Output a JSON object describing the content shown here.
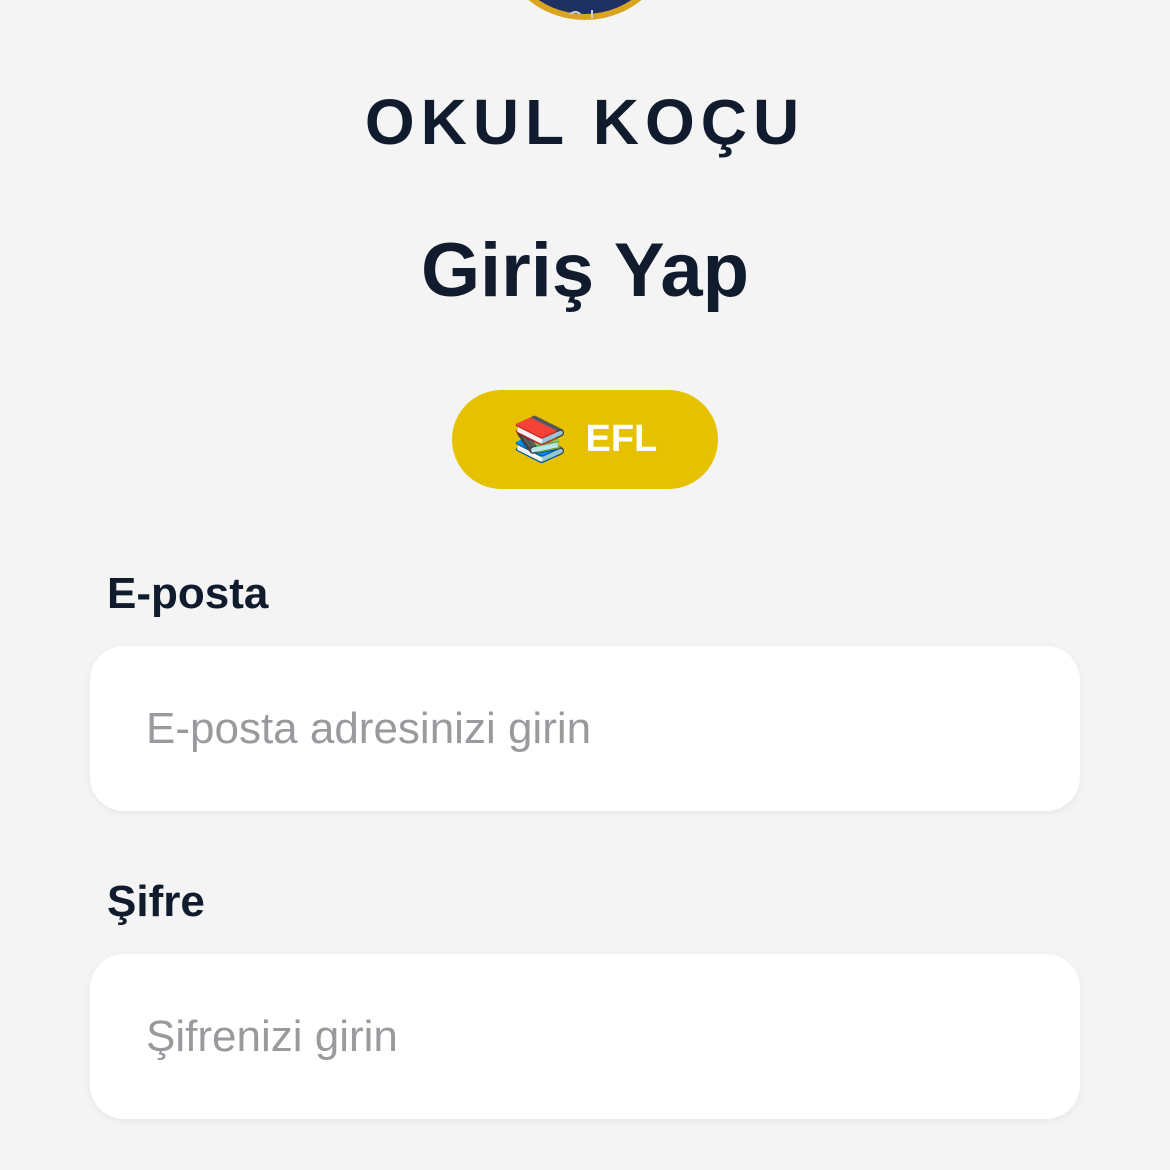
{
  "app": {
    "name": "OKUL KOÇU"
  },
  "page": {
    "title": "Giriş Yap"
  },
  "badge": {
    "icon": "📚",
    "icon_name": "books-icon",
    "label": "EFL",
    "color": "#e5c100"
  },
  "form": {
    "email": {
      "label": "E-posta",
      "value": "",
      "placeholder": "E-posta adresinizi girin"
    },
    "password": {
      "label": "Şifre",
      "value": "",
      "placeholder": "Şifrenizi girin"
    }
  },
  "colors": {
    "background": "#f4f4f5",
    "text": "#101c2e",
    "logo_navy": "#1d3263",
    "logo_gold": "#d9a521"
  }
}
